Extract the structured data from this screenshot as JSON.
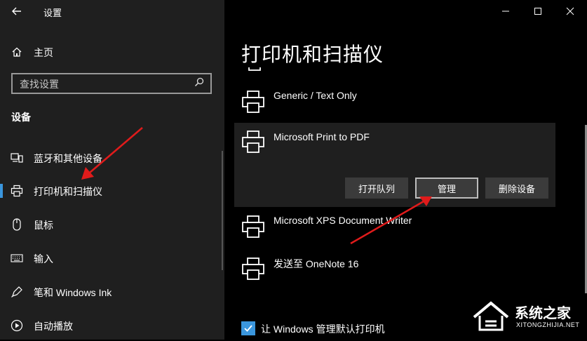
{
  "window": {
    "title": "设置",
    "minimize_icon": "minimize-icon",
    "maximize_icon": "maximize-icon",
    "close_icon": "close-icon"
  },
  "sidebar": {
    "home_label": "主页",
    "search_placeholder": "查找设置",
    "section_label": "设备",
    "items": [
      {
        "label": "蓝牙和其他设备",
        "icon": "bluetooth-devices-icon"
      },
      {
        "label": "打印机和扫描仪",
        "icon": "printer-icon",
        "active": true
      },
      {
        "label": "鼠标",
        "icon": "mouse-icon"
      },
      {
        "label": "输入",
        "icon": "keyboard-icon"
      },
      {
        "label": "笔和 Windows Ink",
        "icon": "pen-icon"
      },
      {
        "label": "自动播放",
        "icon": "autoplay-icon"
      }
    ]
  },
  "main": {
    "title": "打印机和扫描仪",
    "printers": [
      {
        "name": "Generic / Text Only"
      },
      {
        "name": "Microsoft Print to PDF",
        "expanded": true
      },
      {
        "name": "Microsoft XPS Document Writer"
      },
      {
        "name": "发送至 OneNote 16"
      }
    ],
    "buttons": {
      "open_queue": "打开队列",
      "manage": "管理",
      "remove_device": "删除设备"
    },
    "checkbox": {
      "label": "让 Windows 管理默认打印机",
      "checked": true
    }
  },
  "watermark": {
    "text": "系统之家",
    "subtext": "XITONGZHIJIA.NET"
  },
  "colors": {
    "accent": "#3a96dd",
    "annotation_arrow": "#e01b1b"
  }
}
